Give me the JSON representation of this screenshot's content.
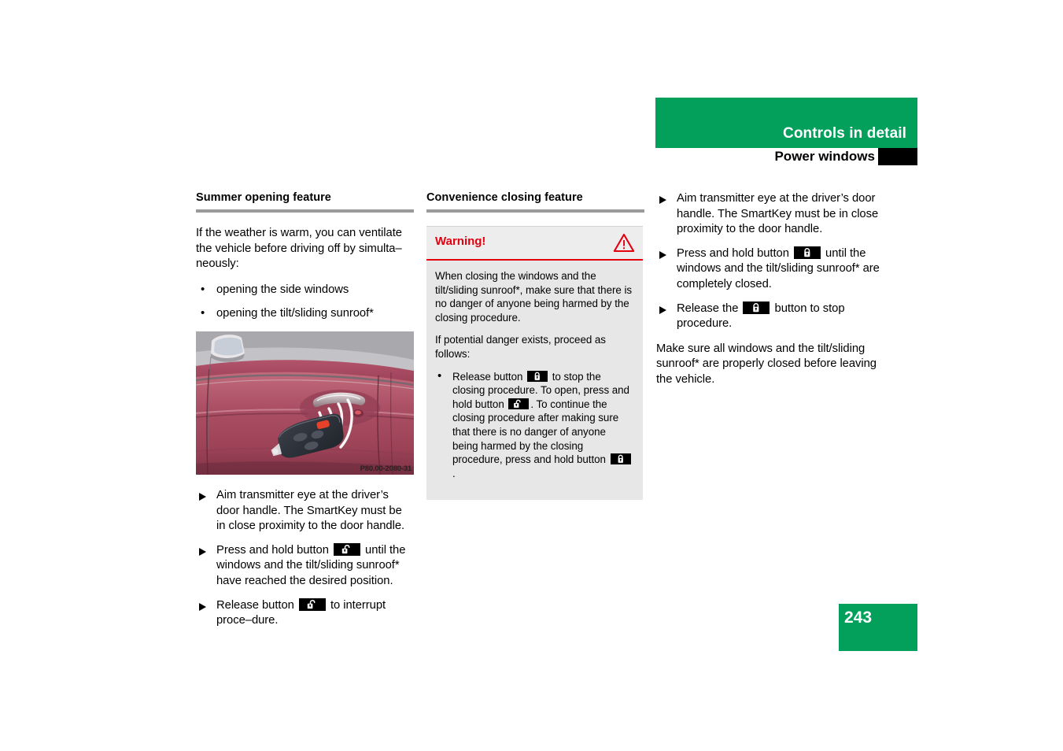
{
  "header": {
    "chapter": "Controls in detail",
    "section": "Power windows",
    "band_color": "#03a05c",
    "tab_color": "#000000"
  },
  "page": {
    "number": "243",
    "number_box_color": "#03a05c"
  },
  "columns": {
    "left": {
      "heading": "Summer opening feature",
      "intro": "If the weather is warm, you can ventilate the vehicle before driving off by simulta–neously:",
      "bullets": [
        "opening the side windows",
        "opening the tilt/sliding sunroof*"
      ],
      "figure": {
        "code": "P80.00-2080-31",
        "alt": "SmartKey transmitting to driver's door handle of a burgundy vehicle",
        "car_color": "#b5566a",
        "key_color": "#2c3038"
      },
      "steps": [
        {
          "text_before": "Aim transmitter eye at the driver’s door handle. The SmartKey must be in close proximity to the door handle.",
          "icon": null,
          "text_after": ""
        },
        {
          "text_before": "Press and hold button ",
          "icon": "unlock-icon",
          "text_after": " until the windows and the tilt/sliding sunroof* have reached the desired position."
        },
        {
          "text_before": "Release button ",
          "icon": "unlock-icon",
          "text_after": " to interrupt proce–dure."
        }
      ]
    },
    "middle": {
      "heading": "Convenience closing feature",
      "warning": {
        "title": "Warning!",
        "icon": "warning-triangle-icon",
        "accent_color": "#e3000f",
        "background": "#e7e7e7",
        "paragraphs": [
          "When closing the windows and the tilt/sliding sunroof*, make sure that there is no danger of anyone being harmed by the closing procedure.",
          "If potential danger exists, proceed as follows:"
        ],
        "bullets": [
          {
            "segments": [
              {
                "type": "text",
                "value": "Release button "
              },
              {
                "type": "icon",
                "value": "lock-icon"
              },
              {
                "type": "text",
                "value": " to stop the closing procedure. To open, press and hold button "
              },
              {
                "type": "icon",
                "value": "unlock-icon"
              },
              {
                "type": "text",
                "value": ". To continue the closing procedure after making sure that there is no danger of anyone being harmed by the closing procedure, press and hold button "
              },
              {
                "type": "icon",
                "value": "lock-icon"
              },
              {
                "type": "text",
                "value": "."
              }
            ]
          }
        ]
      }
    },
    "right": {
      "steps": [
        {
          "text_before": "Aim transmitter eye at the driver’s door handle. The SmartKey must be in close proximity to the door handle.",
          "icon": null,
          "text_after": ""
        },
        {
          "text_before": "Press and hold button ",
          "icon": "lock-icon",
          "text_after": " until the windows and the tilt/sliding sunroof* are completely closed."
        },
        {
          "text_before": "Release the ",
          "icon": "lock-icon",
          "text_after": " button to stop procedure."
        }
      ],
      "closing_note": "Make sure all windows and the tilt/sliding sunroof* are properly closed before leaving the vehicle."
    }
  }
}
